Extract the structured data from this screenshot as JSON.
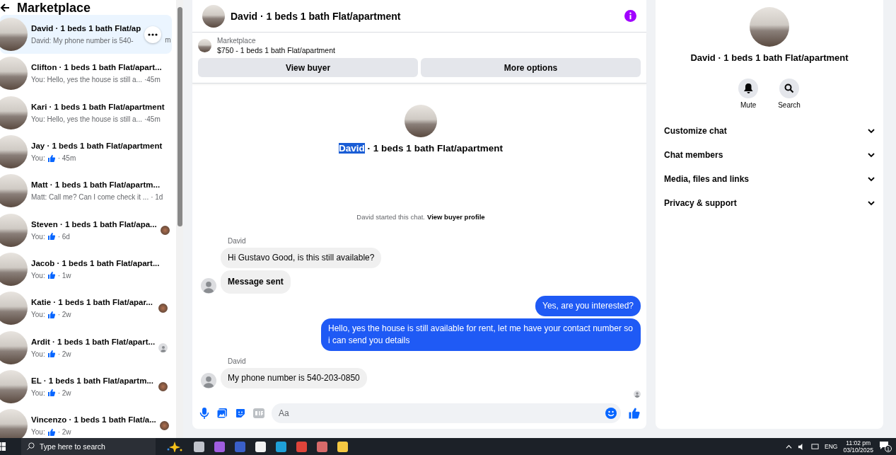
{
  "sidebar": {
    "title": "Marketplace",
    "conversations": [
      {
        "title": "David · 1 beds 1 bath Flat/ap",
        "preview": "David: My phone number is 540-",
        "time": "m",
        "kind": "text",
        "selected": true
      },
      {
        "title": "Clifton · 1 beds 1 bath Flat/apart...",
        "preview": "You: Hello, yes the house is still a...",
        "time": "·45m",
        "kind": "text",
        "selected": false
      },
      {
        "title": "Kari · 1 beds 1 bath Flat/apartment",
        "preview": "You: Hello, yes the house is still a...",
        "time": "·45m",
        "kind": "text",
        "selected": false
      },
      {
        "title": "Jay · 1 beds 1 bath Flat/apartment",
        "preview": "You:",
        "time": "· 45m",
        "kind": "like",
        "selected": false
      },
      {
        "title": "Matt · 1 beds 1 bath Flat/apartm...",
        "preview": "Matt: Call me? Can I come check it ...",
        "time": "· 1d",
        "kind": "text",
        "selected": false
      },
      {
        "title": "Steven · 1 beds 1 bath Flat/apa...",
        "preview": "You:",
        "time": "· 6d",
        "kind": "like",
        "selected": false,
        "seen": {
          "kind": "photo"
        }
      },
      {
        "title": "Jacob · 1 beds 1 bath Flat/apart...",
        "preview": "You:",
        "time": "· 1w",
        "kind": "like",
        "selected": false
      },
      {
        "title": "Katie · 1 beds 1 bath Flat/apar...",
        "preview": "You:",
        "time": "· 2w",
        "kind": "like",
        "selected": false,
        "seen": {
          "kind": "photo"
        }
      },
      {
        "title": "Ardit · 1 beds 1 bath Flat/apart...",
        "preview": "You:",
        "time": "· 2w",
        "kind": "like",
        "selected": false,
        "seen": {
          "kind": "default"
        }
      },
      {
        "title": "EL · 1 beds 1 bath Flat/apartm...",
        "preview": "You:",
        "time": "· 2w",
        "kind": "like",
        "selected": false,
        "seen": {
          "kind": "photo"
        }
      },
      {
        "title": "Vincenzo · 1 beds 1 bath Flat/a...",
        "preview": "You:",
        "time": "· 2w",
        "kind": "like",
        "selected": false,
        "seen": {
          "kind": "photo"
        }
      }
    ]
  },
  "chat": {
    "title": "David · 1 beds 1 bath Flat/apartment",
    "listing": {
      "label": "Marketplace",
      "price_title": "$750 - 1 beds 1 bath Flat/apartment",
      "buttons": [
        "View buyer",
        "More options"
      ]
    },
    "intro": {
      "name": "David",
      "rest": " · 1 beds 1 bath Flat/apartment",
      "name_highlighted": true
    },
    "started": {
      "text": "David started this chat.",
      "link": "View buyer profile"
    },
    "messages": [
      {
        "kind": "incoming",
        "sender": "David",
        "text": "Hi Gustavo Good, is this still available?",
        "avatar": false,
        "bold": false
      },
      {
        "kind": "incoming",
        "text": "Message sent",
        "avatar": true,
        "bold": true
      },
      {
        "kind": "outgoing",
        "text": "Yes, are you interested?"
      },
      {
        "kind": "outgoing",
        "text": "Hello, yes the house is still available for rent, let me have your contact number so i can send you details"
      },
      {
        "kind": "incoming",
        "sender": "David",
        "text": "My phone number is 540-203-0850",
        "avatar": true,
        "bold": false
      }
    ],
    "composer": {
      "placeholder": "Aa"
    }
  },
  "details": {
    "title": "David · 1 beds 1 bath Flat/apartment",
    "actions": [
      {
        "kind": "mute",
        "label": "Mute"
      },
      {
        "kind": "search",
        "label": "Search"
      }
    ],
    "sections": [
      {
        "label": "Customize chat",
        "expanded": false
      },
      {
        "label": "Chat members",
        "expanded": false
      },
      {
        "label": "Media, files and links",
        "expanded": false
      },
      {
        "label": "Privacy & support",
        "expanded": false
      }
    ]
  },
  "taskbar": {
    "search_placeholder": "Type here to search",
    "language": "ENG",
    "time": "11:02 pm",
    "date": "03/10/2025",
    "notifications": "1"
  }
}
